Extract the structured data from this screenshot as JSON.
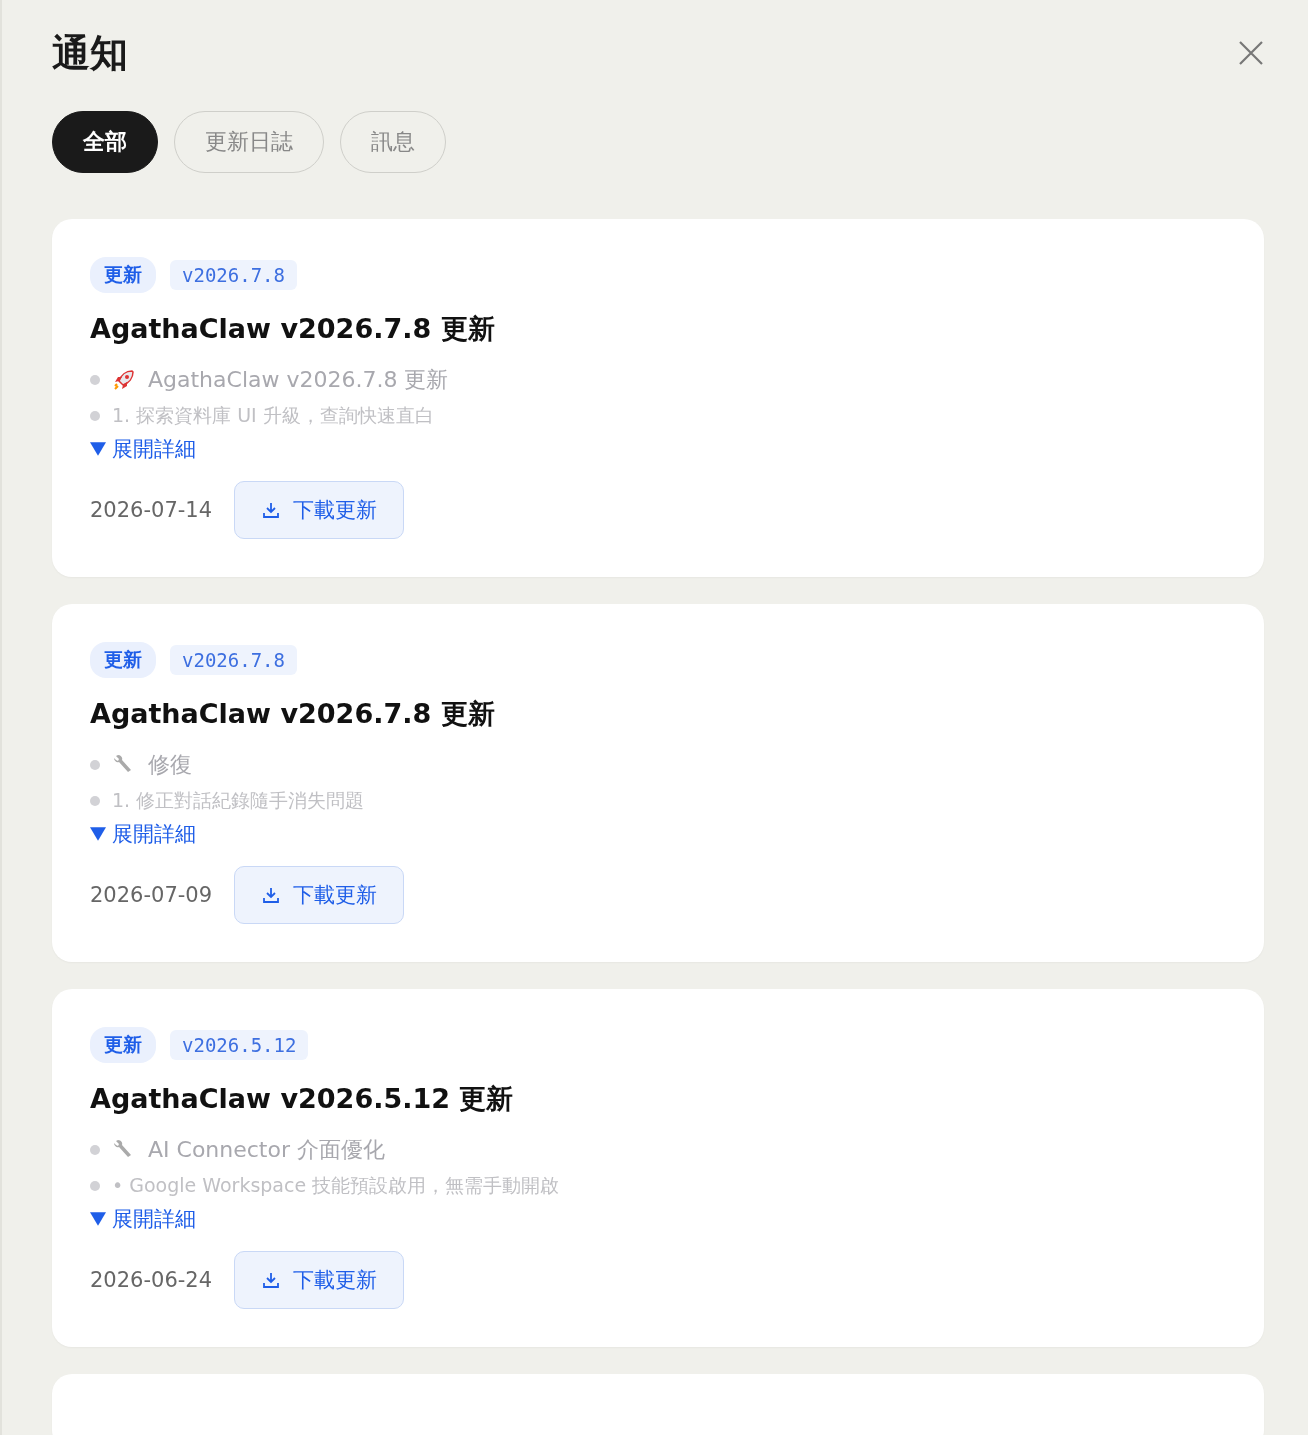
{
  "title": "通知",
  "tabs": [
    {
      "label": "全部",
      "selected": true
    },
    {
      "label": "更新日誌",
      "selected": false
    },
    {
      "label": "訊息",
      "selected": false
    }
  ],
  "cards": [
    {
      "tag": "更新",
      "version": "v2026.7.8",
      "title": "AgathaClaw v2026.7.8 更新",
      "lines": [
        {
          "kind": "rocket",
          "text": "AgathaClaw v2026.7.8 更新"
        },
        {
          "kind": "plain",
          "text": "1. 探索資料庫 UI 升級，查詢快速直白"
        }
      ],
      "expand": "展開詳細",
      "date": "2026-07-14",
      "button": "下載更新"
    },
    {
      "tag": "更新",
      "version": "v2026.7.8",
      "title": "AgathaClaw v2026.7.8 更新",
      "lines": [
        {
          "kind": "wrench",
          "text": "修復"
        },
        {
          "kind": "plain",
          "text": "1. 修正對話紀錄隨手消失問題"
        }
      ],
      "expand": "展開詳細",
      "date": "2026-07-09",
      "button": "下載更新"
    },
    {
      "tag": "更新",
      "version": "v2026.5.12",
      "title": "AgathaClaw v2026.5.12 更新",
      "lines": [
        {
          "kind": "wrench",
          "text": "AI Connector 介面優化"
        },
        {
          "kind": "plain",
          "text": "• Google Workspace 技能預設啟用，無需手動開啟"
        }
      ],
      "expand": "展開詳細",
      "date": "2026-06-24",
      "button": "下載更新"
    }
  ]
}
